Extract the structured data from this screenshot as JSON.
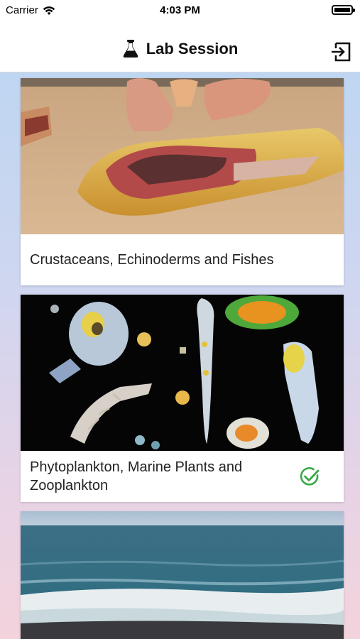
{
  "status_bar": {
    "carrier": "Carrier",
    "time": "4:03 PM",
    "icons": [
      "wifi-icon",
      "battery-icon"
    ]
  },
  "nav": {
    "title": "Lab Session",
    "left_icon": "flask-icon",
    "right_icon": "logout-icon"
  },
  "sessions": [
    {
      "title": "Crustaceans, Echinoderms and Fishes",
      "completed": false,
      "image": "fish-dissection-photo"
    },
    {
      "title": "Phytoplankton, Marine Plants and Zooplankton",
      "completed": true,
      "image": "plankton-photo"
    },
    {
      "title": "",
      "completed": false,
      "image": "ocean-shore-photo"
    }
  ],
  "colors": {
    "check": "#3aa845",
    "background_top": "#b9d6f2",
    "background_bottom": "#f3d3dc"
  }
}
